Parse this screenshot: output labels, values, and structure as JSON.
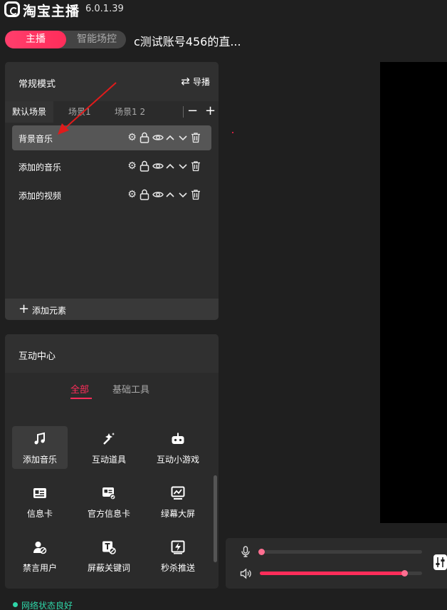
{
  "app": {
    "name": "淘宝主播",
    "version": "6.0.1.39"
  },
  "mode_toggle": {
    "anchor_label": "主播",
    "scene_label": "智能场控"
  },
  "stream_title": "c测试账号456的直...",
  "scene_panel": {
    "mode_label": "常规模式",
    "director_label": "导播",
    "tabs": [
      {
        "label": "默认场景",
        "active": true
      },
      {
        "label": "场景1",
        "active": false
      },
      {
        "label": "场景1 2",
        "active": false
      }
    ],
    "minus_label": "−",
    "plus_label": "+",
    "layers": [
      {
        "name": "背景音乐",
        "selected": true
      },
      {
        "name": "添加的音乐",
        "selected": false
      },
      {
        "name": "添加的视频",
        "selected": false
      }
    ],
    "add_element_label": "添加元素"
  },
  "interaction_center": {
    "title": "互动中心",
    "tabs": [
      {
        "label": "全部",
        "active": true
      },
      {
        "label": "基础工具",
        "active": false
      }
    ],
    "tiles": [
      {
        "label": "添加音乐",
        "icon": "music-note-icon",
        "selected": true
      },
      {
        "label": "互动道具",
        "icon": "magic-props-icon",
        "selected": false
      },
      {
        "label": "互动小游戏",
        "icon": "game-controller-icon",
        "selected": false
      },
      {
        "label": "信息卡",
        "icon": "info-card-icon",
        "selected": false
      },
      {
        "label": "官方信息卡",
        "icon": "official-info-card-icon",
        "selected": false
      },
      {
        "label": "绿幕大屏",
        "icon": "green-screen-icon",
        "selected": false
      },
      {
        "label": "禁言用户",
        "icon": "mute-user-icon",
        "selected": false
      },
      {
        "label": "屏蔽关键词",
        "icon": "block-keyword-icon",
        "selected": false
      },
      {
        "label": "秒杀推送",
        "icon": "flash-sale-icon",
        "selected": false
      }
    ]
  },
  "audio": {
    "mic_level": 0.01,
    "speaker_level": 0.89
  },
  "status": {
    "text": "网络状态良好"
  },
  "colors": {
    "accent": "#ff2d5a",
    "status": "#2fd6a8",
    "panel": "#2b2b2b",
    "background": "#1f1f1f"
  }
}
